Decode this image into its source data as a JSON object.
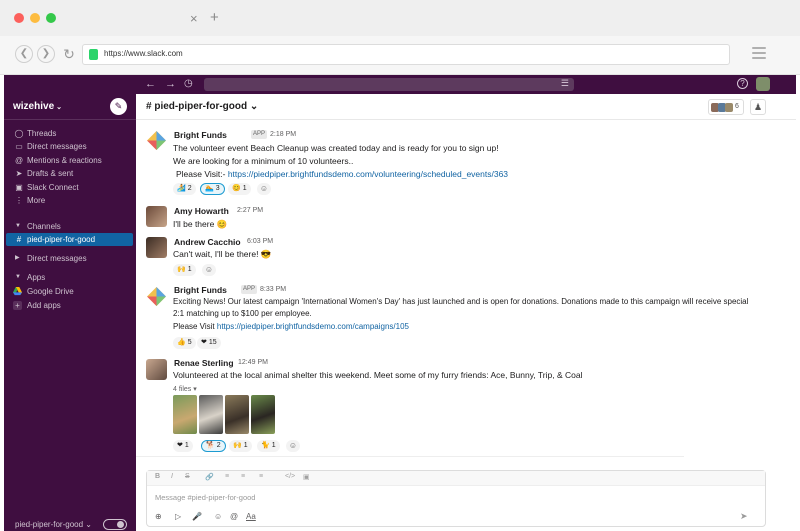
{
  "browser": {
    "url": "https://www.slack.com",
    "tab_close": "×",
    "tab_new": "+"
  },
  "workspace": {
    "name": "wizehive"
  },
  "sidebar": {
    "items": [
      {
        "icon": "threads-icon",
        "label": "Threads"
      },
      {
        "icon": "dm-icon",
        "label": "Direct messages"
      },
      {
        "icon": "mentions-icon",
        "label": "Mentions & reactions"
      },
      {
        "icon": "drafts-icon",
        "label": "Drafts & sent"
      },
      {
        "icon": "connect-icon",
        "label": "Slack Connect"
      },
      {
        "icon": "more-icon",
        "label": "More"
      }
    ],
    "sections": {
      "channels": "Channels",
      "direct_messages": "Direct messages",
      "apps": "Apps"
    },
    "active_channel": "pied-piper-for-good",
    "apps": {
      "google_drive": "Google Drive",
      "add_apps": "Add apps"
    },
    "footer_channel": "pied-piper-for-good"
  },
  "channel": {
    "name": "pied-piper-for-good",
    "member_count": "6"
  },
  "messages": [
    {
      "author": "Bright Funds",
      "badge": "APP",
      "time": "2:18 PM",
      "lines": [
        "The volunteer event Beach Cleanup was created today and is ready for you to sign up!",
        "We are looking for a minimum of 10 volunteers..",
        "Please Visit:- "
      ],
      "link": "https://piedpiper.brightfundsdemo.com/volunteering/scheduled_events/363",
      "reactions": [
        "2",
        "3",
        "1"
      ]
    },
    {
      "author": "Amy Howarth",
      "time": "2:27 PM",
      "text": "I'll be there 😊"
    },
    {
      "author": "Andrew Cacchio",
      "time": "6:03 PM",
      "text": "Can't wait, I'll be there! 😎",
      "reactions": [
        "1"
      ]
    },
    {
      "author": "Bright Funds",
      "badge": "APP",
      "time": "8:33 PM",
      "lines": [
        "Exciting News! Our latest campaign 'International Women's Day' has just launched and is open for donations. Donations made to this campaign will receive special",
        "2:1 matching up to $100 per employee.",
        "Please Visit "
      ],
      "link": "https://piedpiper.brightfundsdemo.com/campaigns/105",
      "reactions": [
        "5",
        "15"
      ]
    },
    {
      "author": "Renae Sterling",
      "time": "12:49 PM",
      "text": "Volunteered at the local animal shelter this weekend.  Meet some of my furry friends: Ace, Bunny, Trip, & Coal",
      "files_label": "4 files",
      "reactions": [
        "1",
        "2",
        "1",
        "1"
      ]
    }
  ],
  "composer": {
    "placeholder": "Message #pied-piper-for-good",
    "format_label": "Aa"
  },
  "colors": {
    "sidebar_bg": "#3f0e40",
    "active_channel": "#1164a3",
    "link": "#1264a3"
  }
}
